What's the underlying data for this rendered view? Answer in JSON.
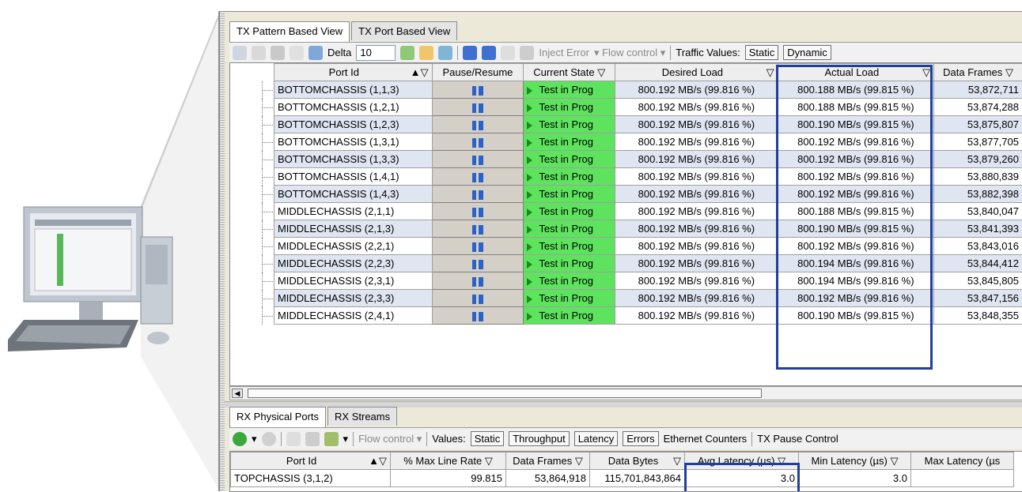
{
  "top_tabs": [
    "TX Pattern Based View",
    "TX Port Based View"
  ],
  "toolbar": {
    "delta_label": "Delta",
    "delta_value": "10",
    "inject_error": "Inject Error",
    "flow_control": "Flow control",
    "traffic_values_label": "Traffic Values:",
    "static": "Static",
    "dynamic": "Dynamic"
  },
  "tx_columns": [
    "Port Id",
    "Pause/Resume",
    "Current State",
    "Desired Load",
    "Actual Load",
    "Data Frames"
  ],
  "tx_rows": [
    {
      "port": "BOTTOMCHASSIS (1,1,3)",
      "state": "Test in Prog",
      "desired": "800.192 MB/s (99.816 %)",
      "actual": "800.188 MB/s (99.815 %)",
      "frames": "53,872,711"
    },
    {
      "port": "BOTTOMCHASSIS (1,2,1)",
      "state": "Test in Prog",
      "desired": "800.192 MB/s (99.816 %)",
      "actual": "800.188 MB/s (99.815 %)",
      "frames": "53,874,288"
    },
    {
      "port": "BOTTOMCHASSIS (1,2,3)",
      "state": "Test in Prog",
      "desired": "800.192 MB/s (99.816 %)",
      "actual": "800.190 MB/s (99.815 %)",
      "frames": "53,875,807"
    },
    {
      "port": "BOTTOMCHASSIS (1,3,1)",
      "state": "Test in Prog",
      "desired": "800.192 MB/s (99.816 %)",
      "actual": "800.192 MB/s (99.816 %)",
      "frames": "53,877,705"
    },
    {
      "port": "BOTTOMCHASSIS (1,3,3)",
      "state": "Test in Prog",
      "desired": "800.192 MB/s (99.816 %)",
      "actual": "800.192 MB/s (99.816 %)",
      "frames": "53,879,260"
    },
    {
      "port": "BOTTOMCHASSIS (1,4,1)",
      "state": "Test in Prog",
      "desired": "800.192 MB/s (99.816 %)",
      "actual": "800.192 MB/s (99.816 %)",
      "frames": "53,880,839"
    },
    {
      "port": "BOTTOMCHASSIS (1,4,3)",
      "state": "Test in Prog",
      "desired": "800.192 MB/s (99.816 %)",
      "actual": "800.192 MB/s (99.816 %)",
      "frames": "53,882,398"
    },
    {
      "port": "MIDDLECHASSIS (2,1,1)",
      "state": "Test in Prog",
      "desired": "800.192 MB/s (99.816 %)",
      "actual": "800.188 MB/s (99.815 %)",
      "frames": "53,840,047"
    },
    {
      "port": "MIDDLECHASSIS (2,1,3)",
      "state": "Test in Prog",
      "desired": "800.192 MB/s (99.816 %)",
      "actual": "800.190 MB/s (99.815 %)",
      "frames": "53,841,393"
    },
    {
      "port": "MIDDLECHASSIS (2,2,1)",
      "state": "Test in Prog",
      "desired": "800.192 MB/s (99.816 %)",
      "actual": "800.192 MB/s (99.816 %)",
      "frames": "53,843,016"
    },
    {
      "port": "MIDDLECHASSIS (2,2,3)",
      "state": "Test in Prog",
      "desired": "800.192 MB/s (99.816 %)",
      "actual": "800.194 MB/s (99.816 %)",
      "frames": "53,844,412"
    },
    {
      "port": "MIDDLECHASSIS (2,3,1)",
      "state": "Test in Prog",
      "desired": "800.192 MB/s (99.816 %)",
      "actual": "800.194 MB/s (99.816 %)",
      "frames": "53,845,805"
    },
    {
      "port": "MIDDLECHASSIS (2,3,3)",
      "state": "Test in Prog",
      "desired": "800.192 MB/s (99.816 %)",
      "actual": "800.192 MB/s (99.816 %)",
      "frames": "53,847,156"
    },
    {
      "port": "MIDDLECHASSIS (2,4,1)",
      "state": "Test in Prog",
      "desired": "800.192 MB/s (99.816 %)",
      "actual": "800.190 MB/s (99.815 %)",
      "frames": "53,848,355"
    }
  ],
  "bottom_tabs": [
    "RX Physical Ports",
    "RX Streams"
  ],
  "toolbar2": {
    "flow_control": "Flow control",
    "values_label": "Values:",
    "static": "Static",
    "throughput": "Throughput",
    "latency": "Latency",
    "errors": "Errors",
    "ethernet_counters": "Ethernet Counters",
    "tx_pause_control": "TX Pause Control"
  },
  "rx_columns": [
    "Port Id",
    "% Max Line Rate",
    "Data Frames",
    "Data Bytes",
    "Avg Latency (µs)",
    "Min Latency (µs)",
    "Max Latency (µs"
  ],
  "rx_rows": [
    {
      "port": "TOPCHASSIS (3,1,2)",
      "rate": "99.815",
      "frames": "53,864,918",
      "bytes": "115,701,843,864",
      "avg": "3.0",
      "min": "3.0",
      "max": ""
    }
  ],
  "colors": {
    "state_green": "#5ee35e",
    "highlight_border": "#1f3f9c",
    "alt_row": "#dfe5f1"
  }
}
